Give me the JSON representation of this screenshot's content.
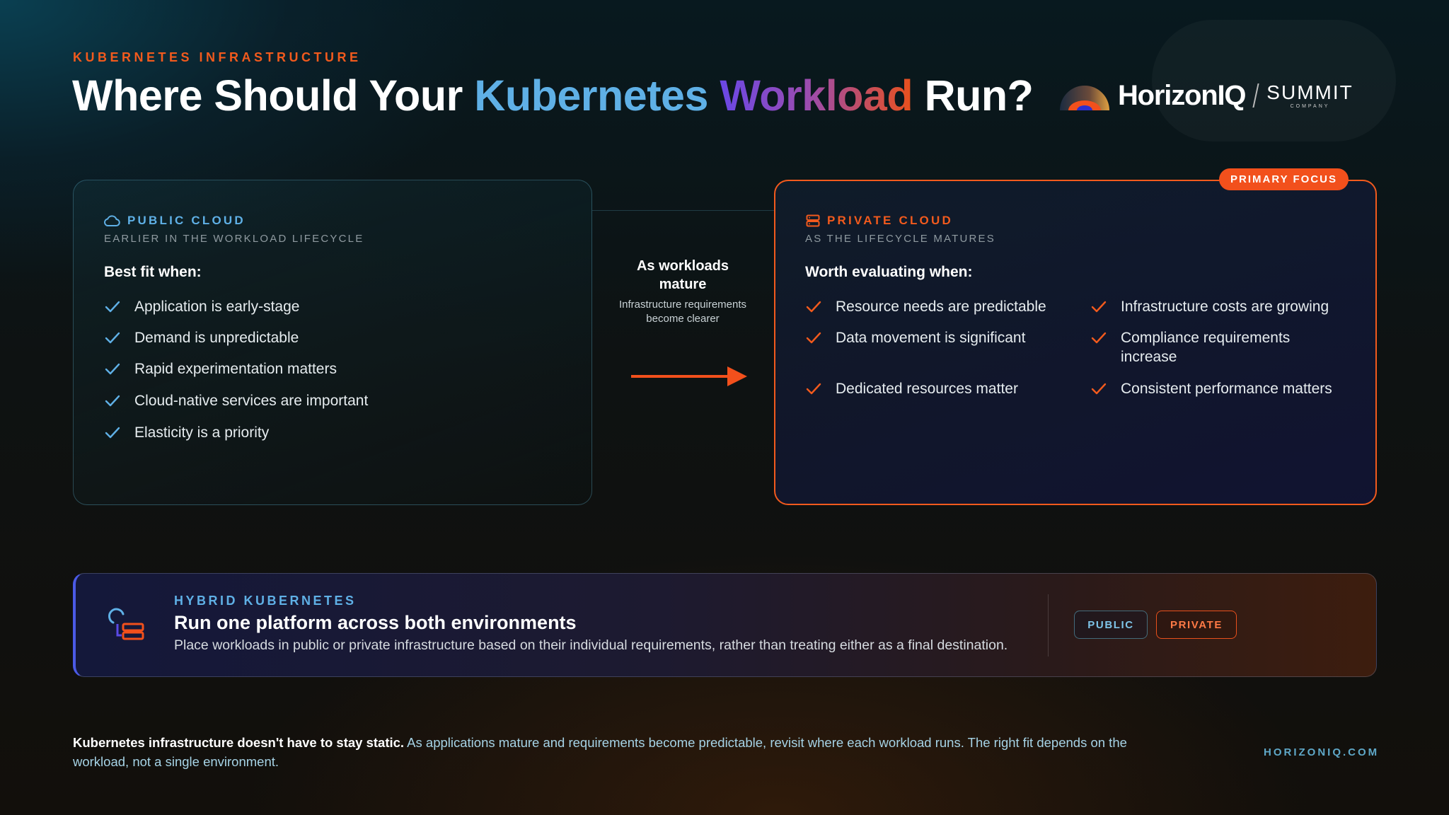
{
  "header": {
    "eyebrow": "KUBERNETES INFRASTRUCTURE",
    "title_part1": "Where Should Your ",
    "title_kubernetes": "Kubernetes",
    "title_workload": "Workload",
    "title_part2": " Run?"
  },
  "brand": {
    "name": "HorizonIQ",
    "partner": "SUMMIT",
    "partner_sub": "COMPANY"
  },
  "public_card": {
    "label": "PUBLIC CLOUD",
    "subtitle": "EARLIER IN THE WORKLOAD LIFECYCLE",
    "fit_title": "Best fit when:",
    "items": [
      "Application is early-stage",
      "Demand is unpredictable",
      "Rapid experimentation matters",
      "Cloud-native services are important",
      "Elasticity is a priority"
    ],
    "accent": "#5fb0e6"
  },
  "transition": {
    "title": "As workloads mature",
    "subtitle": "Infrastructure requirements become clearer"
  },
  "private_card": {
    "badge": "PRIMARY FOCUS",
    "label": "PRIVATE CLOUD",
    "subtitle": "AS THE LIFECYCLE MATURES",
    "fit_title": "Worth evaluating when:",
    "items": [
      "Resource needs are predictable",
      "Infrastructure costs are growing",
      "Data movement is significant",
      "Compliance requirements increase",
      "Dedicated resources matter",
      "Consistent performance matters"
    ],
    "accent": "#f25a1d"
  },
  "hybrid": {
    "eyebrow": "HYBRID KUBERNETES",
    "title": "Run one platform across both environments",
    "description": "Place workloads in public or private infrastructure based on their individual requirements, rather than treating either as a final destination.",
    "tag_public": "PUBLIC",
    "tag_private": "PRIVATE"
  },
  "footer": {
    "lead": "Kubernetes infrastructure doesn't have to stay static.",
    "body": " As applications mature and requirements become predictable, revisit where each workload runs. The right fit depends on the workload, not a single environment.",
    "site": "HORIZONIQ.COM"
  }
}
